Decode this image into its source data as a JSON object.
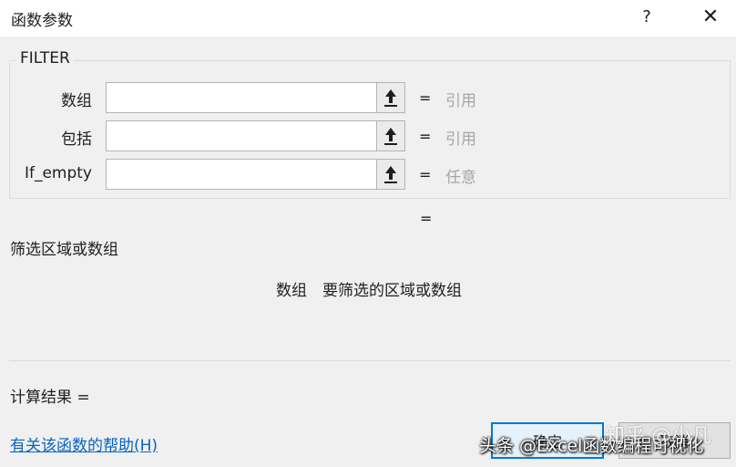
{
  "dialog": {
    "title": "函数参数",
    "help_glyph": "?",
    "close_glyph": "✕"
  },
  "function": {
    "name": "FILTER",
    "args": [
      {
        "label": "数组",
        "value": "",
        "type_hint": "引用"
      },
      {
        "label": "包括",
        "value": "",
        "type_hint": "引用"
      },
      {
        "label": "If_empty",
        "value": "",
        "type_hint": "任意"
      }
    ],
    "equals_sign": "=",
    "result_equals": "=",
    "description": "筛选区域或数组",
    "arg_help_name": "数组",
    "arg_help_text": "要筛选的区域或数组"
  },
  "footer": {
    "calc_result_label": "计算结果 =",
    "help_link": "有关该函数的帮助(H)",
    "ok_label": "确定",
    "cancel_label": "取消"
  },
  "watermark": {
    "text": "头条 @Excel函数编程可视化",
    "text2": "知乎 @小凡"
  },
  "colors": {
    "accent": "#0078d7",
    "link": "#0563c1",
    "hint_gray": "#a6a6a6",
    "background": "#f0f0f0"
  },
  "icons": {
    "ref_button": "collapse-dialog-arrow-icon",
    "close": "close-icon",
    "help": "help-icon"
  }
}
